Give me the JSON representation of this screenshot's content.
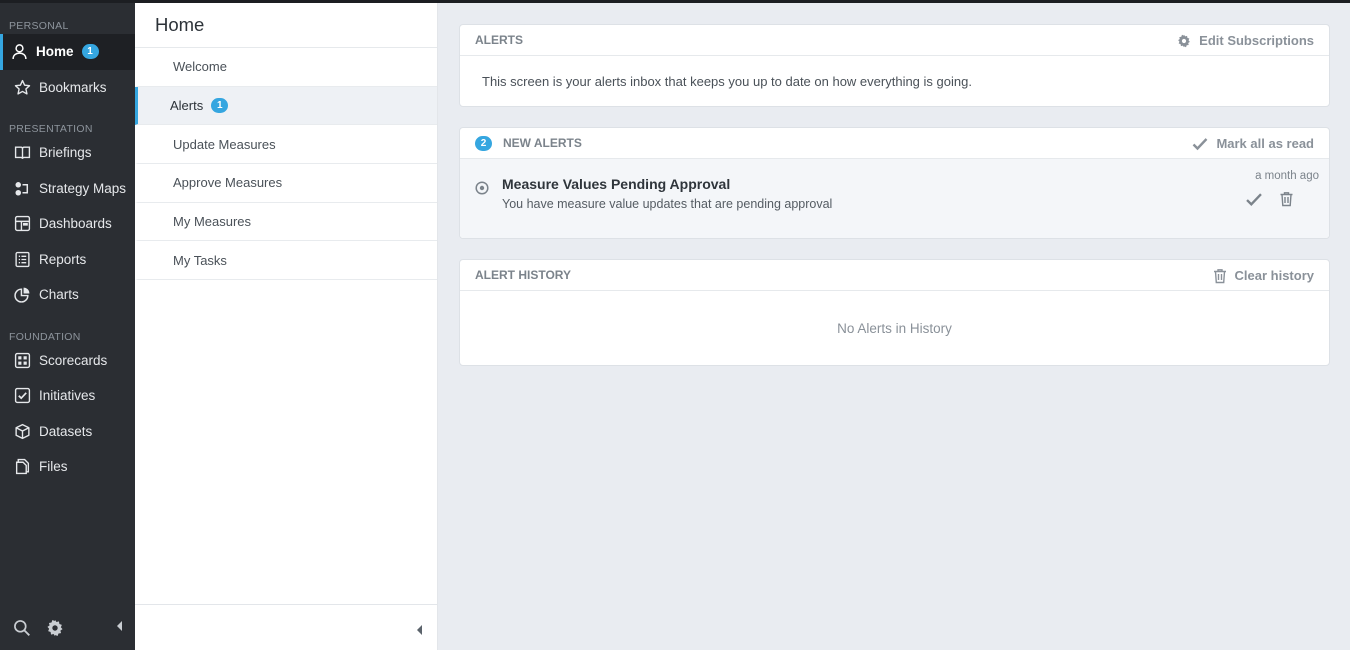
{
  "sidebar": {
    "sections": [
      {
        "label": "PERSONAL",
        "items": [
          {
            "label": "Home",
            "icon": "user-icon",
            "badge": "1",
            "active": true
          },
          {
            "label": "Bookmarks",
            "icon": "star-icon"
          }
        ]
      },
      {
        "label": "PRESENTATION",
        "items": [
          {
            "label": "Briefings",
            "icon": "book-icon"
          },
          {
            "label": "Strategy Maps",
            "icon": "strategy-map-icon"
          },
          {
            "label": "Dashboards",
            "icon": "dashboard-icon"
          },
          {
            "label": "Reports",
            "icon": "report-icon"
          },
          {
            "label": "Charts",
            "icon": "pie-chart-icon"
          }
        ]
      },
      {
        "label": "FOUNDATION",
        "items": [
          {
            "label": "Scorecards",
            "icon": "scorecard-icon"
          },
          {
            "label": "Initiatives",
            "icon": "checkbox-icon"
          },
          {
            "label": "Datasets",
            "icon": "cube-icon"
          },
          {
            "label": "Files",
            "icon": "files-icon"
          }
        ]
      }
    ],
    "bottom_icons": [
      "search-icon",
      "gear-icon",
      "collapse-left-icon"
    ]
  },
  "home_panel": {
    "title": "Home",
    "items": [
      {
        "label": "Welcome"
      },
      {
        "label": "Alerts",
        "badge": "1",
        "active": true
      },
      {
        "label": "Update Measures"
      },
      {
        "label": "Approve Measures"
      },
      {
        "label": "My Measures"
      },
      {
        "label": "My Tasks"
      }
    ]
  },
  "alerts_card": {
    "title": "ALERTS",
    "action_label": "Edit Subscriptions",
    "description": "This screen is your alerts inbox that keeps you up to date on how everything is going."
  },
  "new_alerts_card": {
    "count": "2",
    "title": "NEW ALERTS",
    "action_label": "Mark all as read",
    "alert": {
      "title": "Measure Values Pending Approval",
      "description": "You have measure value updates that are pending approval",
      "time": "a month ago"
    }
  },
  "history_card": {
    "title": "ALERT HISTORY",
    "action_label": "Clear history",
    "empty_text": "No Alerts in History"
  },
  "colors": {
    "accent": "#35a6e0",
    "sidebar_bg": "#2b2e33",
    "main_bg": "#e9ecf1"
  }
}
